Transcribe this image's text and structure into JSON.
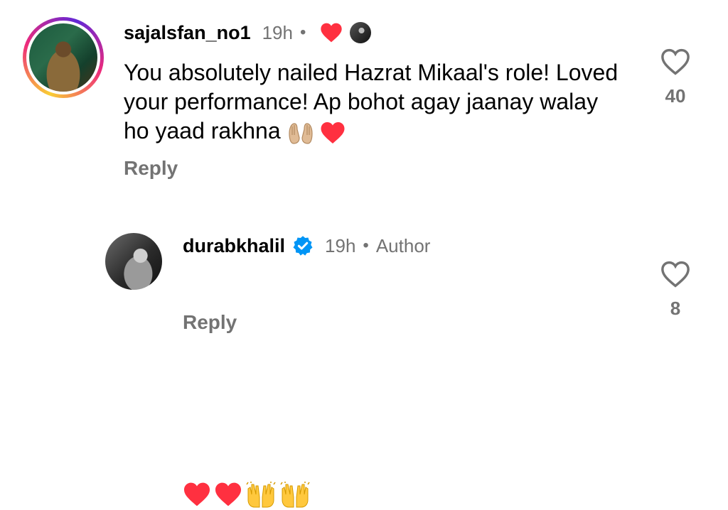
{
  "comments": [
    {
      "username": "sajalsfan_no1",
      "time": "19h",
      "separator": "•",
      "text": "You absolutely nailed Hazrat Mikaal's role! Loved your performance! Ap bohot agay jaanay walay ho yaad rakhna",
      "reply_label": "Reply",
      "like_count": "40",
      "liked_by_author": true,
      "icons": [
        "avatar-story-ring",
        "liked-heart-icon",
        "author-mini-avatar",
        "heart-outline-icon",
        "palms-up-emoji",
        "red-heart-emoji"
      ]
    },
    {
      "username": "durabkhalil",
      "time": "19h",
      "separator": "•",
      "author_label": "Author",
      "text": "❤️❤️🙌🙌",
      "reply_label": "Reply",
      "like_count": "8",
      "verified": true,
      "icons": [
        "verified-badge-icon",
        "heart-outline-icon",
        "red-heart-emoji",
        "raising-hands-emoji"
      ]
    }
  ],
  "colors": {
    "text": "#000000",
    "secondary": "#737373",
    "like_red": "#ff3040",
    "verified_blue": "#0095f6"
  }
}
